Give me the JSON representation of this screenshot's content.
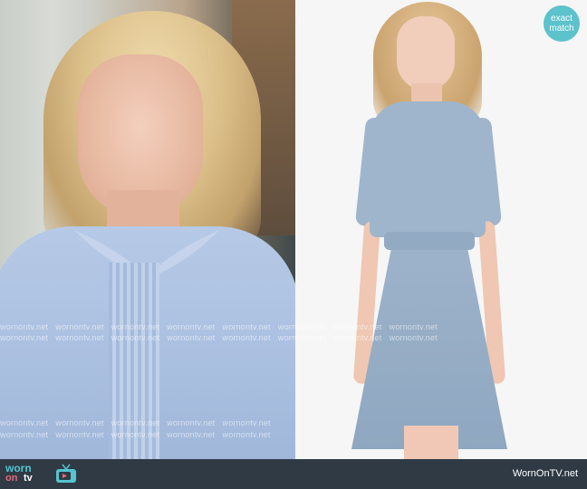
{
  "badge": {
    "line1": "exact",
    "line2": "match"
  },
  "watermark": {
    "text": "wornontv.net"
  },
  "footer": {
    "logo_worn": "worn",
    "logo_on": "on",
    "logo_tv": "tv",
    "site": "WornOnTV.net"
  },
  "colors": {
    "badge": "#5cc2cc",
    "bar": "#2f3a45",
    "logo_teal": "#55c4cf",
    "logo_pink": "#e86a7c",
    "dress_blue": "#9fb5cc"
  }
}
